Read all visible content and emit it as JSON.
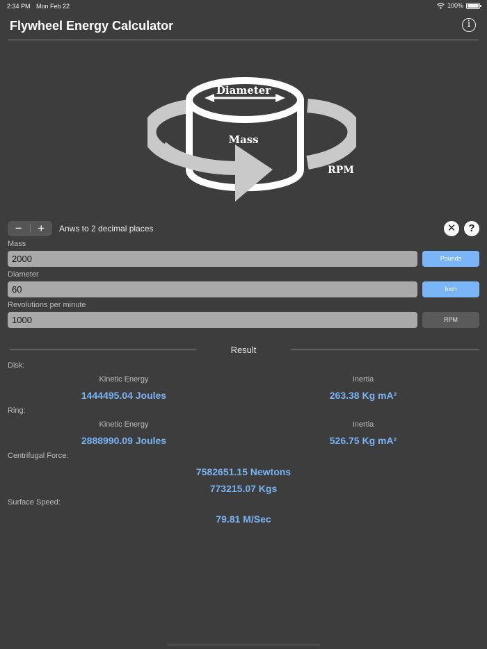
{
  "status": {
    "time": "2:34 PM",
    "date": "Mon Feb 22",
    "battery": "100%"
  },
  "header": {
    "title": "Flywheel Energy Calculator",
    "info_glyph": "i"
  },
  "diagram": {
    "diameter_label": "Diameter",
    "mass_label": "Mass",
    "rpm_label": "RPM"
  },
  "toolbar": {
    "minus": "−",
    "plus": "+",
    "decimals_label": "Anws to 2 decimal places",
    "clear_glyph": "✕",
    "help_glyph": "?"
  },
  "fields": {
    "mass": {
      "label": "Mass",
      "value": "2000",
      "unit": "Pounds"
    },
    "diameter": {
      "label": "Diameter",
      "value": "60",
      "unit": "Inch"
    },
    "rpm": {
      "label": "Revolutions per minute",
      "value": "1000",
      "unit": "RPM"
    }
  },
  "result": {
    "title": "Result",
    "disk": {
      "label": "Disk:",
      "ke_label": "Kinetic Energy",
      "ke_value": "1444495.04 Joules",
      "inertia_label": "Inertia",
      "inertia_value": "263.38 Kg mA²"
    },
    "ring": {
      "label": "Ring:",
      "ke_label": "Kinetic Energy",
      "ke_value": "2888990.09 Joules",
      "inertia_label": "Inertia",
      "inertia_value": "526.75 Kg mA²"
    },
    "centrifugal": {
      "label": "Centrifugal Force:",
      "newtons": "7582651.15 Newtons",
      "kgs": "773215.07 Kgs"
    },
    "surface": {
      "label": "Surface Speed:",
      "value": "79.81 M/Sec"
    }
  },
  "colors": {
    "background": "#3d3d3d",
    "accent": "#79b3f2",
    "unit_button": "#7ab6f7"
  }
}
